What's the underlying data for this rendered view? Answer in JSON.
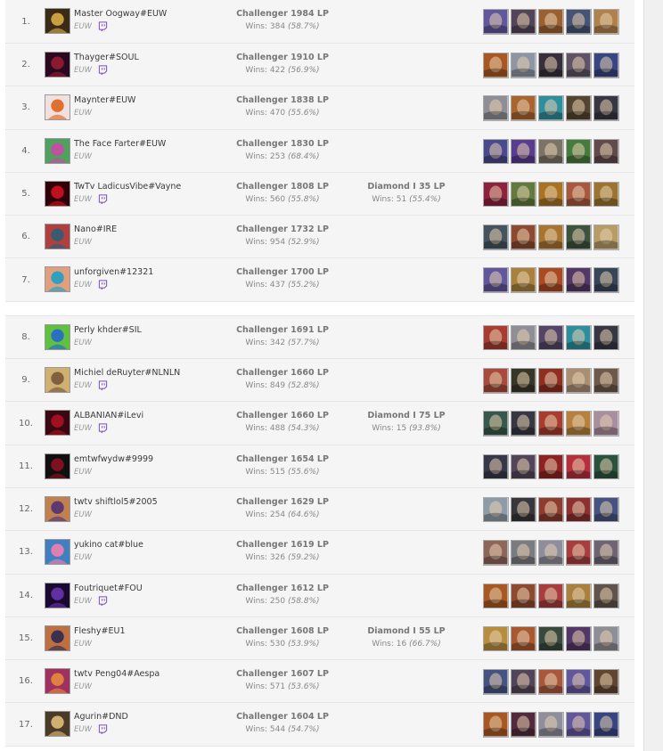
{
  "leaderboard": {
    "rows": [
      {
        "rank": "1.",
        "name": "Master Oogway#EUW",
        "region": "EUW",
        "twitch": true,
        "solo_tier": "Challenger 1984 LP",
        "solo_wins": "Wins: 384",
        "solo_pct": "(58.7%)",
        "flex_tier": "",
        "flex_wins": "",
        "flex_pct": "",
        "avatar_colors": [
          "#c8a040",
          "#3a2a18"
        ],
        "champ_colors": [
          "#6a5fb0",
          "#5a4a60",
          "#b06a30",
          "#4a5a80",
          "#c89050"
        ]
      },
      {
        "rank": "2.",
        "name": "Thayger#SOUL",
        "region": "EUW",
        "twitch": true,
        "solo_tier": "Challenger 1910 LP",
        "solo_wins": "Wins: 422",
        "solo_pct": "(56.9%)",
        "flex_tier": "",
        "flex_wins": "",
        "flex_pct": "",
        "avatar_colors": [
          "#8a1a30",
          "#2a0a20"
        ],
        "champ_colors": [
          "#c06020",
          "#a0a8b8",
          "#3a3040",
          "#6a5a70",
          "#3a4a90"
        ]
      },
      {
        "rank": "3.",
        "name": "Maynter#EUW",
        "region": "EUW",
        "twitch": false,
        "solo_tier": "Challenger 1838 LP",
        "solo_wins": "Wins: 470",
        "solo_pct": "(55.6%)",
        "flex_tier": "",
        "flex_wins": "",
        "flex_pct": "",
        "avatar_colors": [
          "#e07030",
          "#f0e0e0"
        ],
        "champ_colors": [
          "#a0a0a8",
          "#c07030",
          "#30a0b0",
          "#5a4a30",
          "#3a3a48"
        ]
      },
      {
        "rank": "4.",
        "name": "The Face Farter#EUW",
        "region": "EUW",
        "twitch": false,
        "solo_tier": "Challenger 1830 LP",
        "solo_wins": "Wins: 253",
        "solo_pct": "(68.4%)",
        "flex_tier": "",
        "flex_wins": "",
        "flex_pct": "",
        "avatar_colors": [
          "#c050a0",
          "#50a060"
        ],
        "champ_colors": [
          "#5050a0",
          "#6040a0",
          "#8a8070",
          "#4a8a40",
          "#6a5050"
        ]
      },
      {
        "rank": "5.",
        "name": "TwTv LadicusVibe#Vayne",
        "region": "EUW",
        "twitch": true,
        "solo_tier": "Challenger 1808 LP",
        "solo_wins": "Wins: 560",
        "solo_pct": "(55.8%)",
        "flex_tier": "Diamond I 35 LP",
        "flex_wins": "Wins: 51",
        "flex_pct": "(55.4%)",
        "avatar_colors": [
          "#c01020",
          "#300008"
        ],
        "champ_colors": [
          "#a02040",
          "#6a8a40",
          "#c08020",
          "#c06040",
          "#b08030"
        ]
      },
      {
        "rank": "6.",
        "name": "Nano#IRE",
        "region": "EUW",
        "twitch": false,
        "solo_tier": "Challenger 1732 LP",
        "solo_wins": "Wins: 954",
        "solo_pct": "(52.9%)",
        "flex_tier": "",
        "flex_wins": "",
        "flex_pct": "",
        "avatar_colors": [
          "#3a5a70",
          "#b04040"
        ],
        "champ_colors": [
          "#4a5a6a",
          "#a05030",
          "#c08030",
          "#405a40",
          "#d0b070"
        ]
      },
      {
        "rank": "7.",
        "name": "unforgiven#12321",
        "region": "EUW",
        "twitch": true,
        "solo_tier": "Challenger 1700 LP",
        "solo_wins": "Wins: 437",
        "solo_pct": "(55.2%)",
        "flex_tier": "",
        "flex_wins": "",
        "flex_pct": "",
        "avatar_colors": [
          "#30a0c0",
          "#e0a080"
        ],
        "champ_colors": [
          "#6a5fb0",
          "#c09040",
          "#c05020",
          "#5a3a70",
          "#3a4a60"
        ]
      },
      {
        "rank": "8.",
        "name": "Perly khder#SIL",
        "region": "EUW",
        "twitch": false,
        "solo_tier": "Challenger 1691 LP",
        "solo_wins": "Wins: 342",
        "solo_pct": "(57.7%)",
        "flex_tier": "",
        "flex_wins": "",
        "flex_pct": "",
        "avatar_colors": [
          "#2a70c0",
          "#60c040"
        ],
        "champ_colors": [
          "#c04030",
          "#a0a0a8",
          "#5a4a70",
          "#30a0b0",
          "#3a3a48"
        ]
      },
      {
        "rank": "9.",
        "name": "Michiel deRuyter#NLNLN",
        "region": "EUW",
        "twitch": true,
        "solo_tier": "Challenger 1660 LP",
        "solo_wins": "Wins: 849",
        "solo_pct": "(52.8%)",
        "flex_tier": "",
        "flex_wins": "",
        "flex_pct": "",
        "avatar_colors": [
          "#806040",
          "#d0b070"
        ],
        "champ_colors": [
          "#c05040",
          "#3a3a28",
          "#a03020",
          "#c0a080",
          "#7a6050"
        ]
      },
      {
        "rank": "10.",
        "name": "ALBANIAN#iLevi",
        "region": "EUW",
        "twitch": true,
        "solo_tier": "Challenger 1660 LP",
        "solo_wins": "Wins: 488",
        "solo_pct": "(54.3%)",
        "flex_tier": "Diamond I 75 LP",
        "flex_wins": "Wins: 15",
        "flex_pct": "(93.8%)",
        "avatar_colors": [
          "#a01020",
          "#3a0810"
        ],
        "champ_colors": [
          "#3a6050",
          "#3a3a48",
          "#c04030",
          "#d09040",
          "#c0a0b0"
        ]
      },
      {
        "rank": "11.",
        "name": "emtwfwydw#9999",
        "region": "EUW",
        "twitch": false,
        "solo_tier": "Challenger 1654 LP",
        "solo_wins": "Wins: 515",
        "solo_pct": "(55.6%)",
        "flex_tier": "",
        "flex_wins": "",
        "flex_pct": "",
        "avatar_colors": [
          "#801020",
          "#101010"
        ],
        "champ_colors": [
          "#3a3a50",
          "#5a4a60",
          "#a02020",
          "#d03040",
          "#2a5a40"
        ]
      },
      {
        "rank": "12.",
        "name": "twtv shiftlol5#2005",
        "region": "EUW",
        "twitch": false,
        "solo_tier": "Challenger 1629 LP",
        "solo_wins": "Wins: 254",
        "solo_pct": "(64.6%)",
        "flex_tier": "",
        "flex_wins": "",
        "flex_pct": "",
        "avatar_colors": [
          "#5a3a70",
          "#c08050"
        ],
        "champ_colors": [
          "#a0b0c0",
          "#3a3a40",
          "#a04030",
          "#a03030",
          "#4a5a90"
        ]
      },
      {
        "rank": "13.",
        "name": "yukino cat#blue",
        "region": "EUW",
        "twitch": false,
        "solo_tier": "Challenger 1619 LP",
        "solo_wins": "Wins: 326",
        "solo_pct": "(59.2%)",
        "flex_tier": "",
        "flex_wins": "",
        "flex_pct": "",
        "avatar_colors": [
          "#e080b0",
          "#4080c0"
        ],
        "champ_colors": [
          "#a07060",
          "#8a8a90",
          "#a0a0b0",
          "#c04040",
          "#7a7080"
        ]
      },
      {
        "rank": "14.",
        "name": "Foutriquet#FOU",
        "region": "EUW",
        "twitch": true,
        "solo_tier": "Challenger 1612 LP",
        "solo_wins": "Wins: 250",
        "solo_pct": "(58.8%)",
        "flex_tier": "",
        "flex_wins": "",
        "flex_pct": "",
        "avatar_colors": [
          "#6030a0",
          "#1a0a30"
        ],
        "champ_colors": [
          "#c06020",
          "#a05030",
          "#c04040",
          "#c09040",
          "#6a5a50"
        ]
      },
      {
        "rank": "15.",
        "name": "Fleshy#EU1",
        "region": "EUW",
        "twitch": false,
        "solo_tier": "Challenger 1608 LP",
        "solo_wins": "Wins: 530",
        "solo_pct": "(53.9%)",
        "flex_tier": "Diamond I 55 LP",
        "flex_wins": "Wins: 16",
        "flex_pct": "(66.7%)",
        "avatar_colors": [
          "#3a3050",
          "#c07040"
        ],
        "champ_colors": [
          "#d0a040",
          "#c06030",
          "#3a5040",
          "#5a3a70",
          "#a0a0a8"
        ]
      },
      {
        "rank": "16.",
        "name": "twtv Peng04#Aespa",
        "region": "EUW",
        "twitch": false,
        "solo_tier": "Challenger 1607 LP",
        "solo_wins": "Wins: 571",
        "solo_pct": "(53.6%)",
        "flex_tier": "",
        "flex_wins": "",
        "flex_pct": "",
        "avatar_colors": [
          "#e08040",
          "#a03060"
        ],
        "champ_colors": [
          "#4a5a90",
          "#5a4a60",
          "#c06040",
          "#6a5fb0",
          "#6a4a30"
        ]
      },
      {
        "rank": "17.",
        "name": "Agurin#DND",
        "region": "EUW",
        "twitch": true,
        "solo_tier": "Challenger 1604 LP",
        "solo_wins": "Wins: 544",
        "solo_pct": "(54.7%)",
        "flex_tier": "",
        "flex_wins": "",
        "flex_pct": "",
        "avatar_colors": [
          "#d0b070",
          "#4a3a28"
        ],
        "champ_colors": [
          "#c06020",
          "#5a2a40",
          "#a0a0b0",
          "#6a5fb0",
          "#3a4a90"
        ]
      }
    ]
  }
}
